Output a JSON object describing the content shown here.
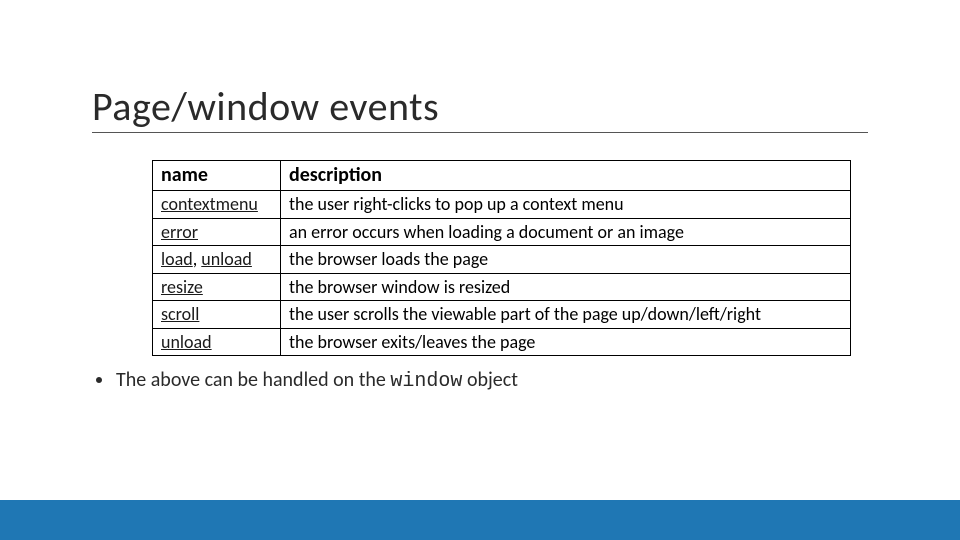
{
  "title": "Page/window events",
  "table": {
    "headers": {
      "name": "name",
      "description": "description"
    },
    "rows": [
      {
        "name_links": [
          "contextmenu"
        ],
        "sep": "",
        "desc": "the user right-clicks to pop up a context menu"
      },
      {
        "name_links": [
          "error"
        ],
        "sep": "",
        "desc": "an error occurs when loading a document or an image"
      },
      {
        "name_links": [
          "load",
          "unload"
        ],
        "sep": ", ",
        "desc": "the browser loads the page"
      },
      {
        "name_links": [
          "resize"
        ],
        "sep": "",
        "desc": "the browser window is resized"
      },
      {
        "name_links": [
          "scroll"
        ],
        "sep": "",
        "desc": "the user scrolls the viewable part of the page up/down/left/right"
      },
      {
        "name_links": [
          "unload"
        ],
        "sep": "",
        "desc": "the browser exits/leaves the page"
      }
    ]
  },
  "bullet": {
    "pre": "The above can be handled on the ",
    "code": "window",
    "post": " object"
  }
}
